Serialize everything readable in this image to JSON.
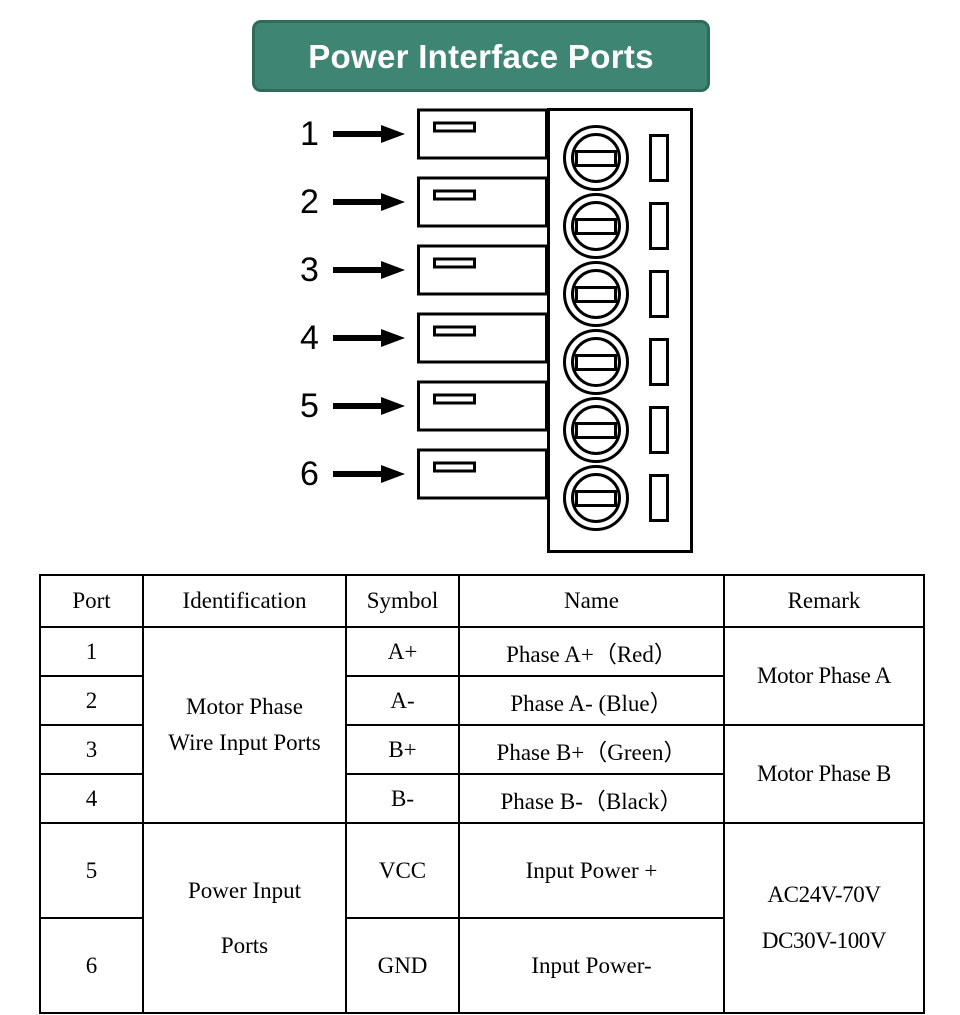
{
  "title": {
    "text": "Power Interface Ports",
    "background_color": "#3f8573",
    "border_color": "#2f6b5b",
    "text_color": "#ffffff"
  },
  "diagram": {
    "name": "power-connector-terminal-block",
    "port_labels": [
      "1",
      "2",
      "3",
      "4",
      "5",
      "6"
    ],
    "terminal_count": 6
  },
  "table": {
    "headers": {
      "port": "Port",
      "identification": "Identification",
      "symbol": "Symbol",
      "name": "Name",
      "remark": "Remark"
    },
    "ports": [
      "1",
      "2",
      "3",
      "4",
      "5",
      "6"
    ],
    "identification": {
      "motor_line1": "Motor  Phase",
      "motor_line2": "Wire Input Ports",
      "power_line1": "Power Input",
      "power_line2": "Ports"
    },
    "symbols": [
      "A+",
      "A-",
      "B+",
      "B-",
      "VCC",
      "GND"
    ],
    "names": [
      "Phase A+（Red）",
      "Phase A- (Blue）",
      "Phase B+（Green）",
      "Phase B-（Black）",
      "Input Power +",
      "Input Power-"
    ],
    "remarks": {
      "phase_a": "Motor Phase A",
      "phase_b": "Motor Phase B",
      "power_ac": "AC24V-70V",
      "power_dc": "DC30V-100V"
    }
  }
}
